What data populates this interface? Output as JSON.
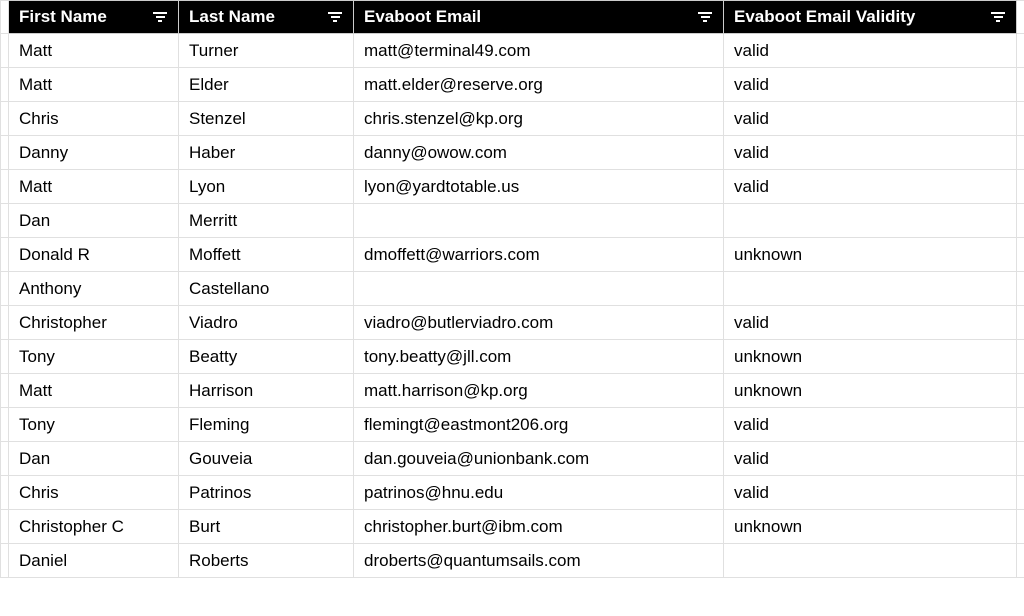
{
  "columns": [
    {
      "key": "first_name",
      "label": "First Name"
    },
    {
      "key": "last_name",
      "label": "Last Name"
    },
    {
      "key": "email",
      "label": "Evaboot Email"
    },
    {
      "key": "validity",
      "label": "Evaboot Email Validity"
    }
  ],
  "rows": [
    {
      "first_name": "Matt",
      "last_name": "Turner",
      "email": "matt@terminal49.com",
      "validity": "valid"
    },
    {
      "first_name": "Matt",
      "last_name": "Elder",
      "email": "matt.elder@reserve.org",
      "validity": "valid"
    },
    {
      "first_name": "Chris",
      "last_name": "Stenzel",
      "email": "chris.stenzel@kp.org",
      "validity": "valid"
    },
    {
      "first_name": "Danny",
      "last_name": "Haber",
      "email": "danny@owow.com",
      "validity": "valid"
    },
    {
      "first_name": "Matt",
      "last_name": "Lyon",
      "email": "lyon@yardtotable.us",
      "validity": "valid"
    },
    {
      "first_name": "Dan",
      "last_name": "Merritt",
      "email": "",
      "validity": ""
    },
    {
      "first_name": "Donald R",
      "last_name": "Moffett",
      "email": "dmoffett@warriors.com",
      "validity": "unknown"
    },
    {
      "first_name": "Anthony",
      "last_name": "Castellano",
      "email": "",
      "validity": ""
    },
    {
      "first_name": "Christopher",
      "last_name": "Viadro",
      "email": "viadro@butlerviadro.com",
      "validity": "valid"
    },
    {
      "first_name": "Tony",
      "last_name": "Beatty",
      "email": "tony.beatty@jll.com",
      "validity": "unknown"
    },
    {
      "first_name": "Matt",
      "last_name": "Harrison",
      "email": "matt.harrison@kp.org",
      "validity": "unknown"
    },
    {
      "first_name": "Tony",
      "last_name": "Fleming",
      "email": "flemingt@eastmont206.org",
      "validity": "valid"
    },
    {
      "first_name": "Dan",
      "last_name": "Gouveia",
      "email": "dan.gouveia@unionbank.com",
      "validity": "valid"
    },
    {
      "first_name": "Chris",
      "last_name": "Patrinos",
      "email": "patrinos@hnu.edu",
      "validity": "valid"
    },
    {
      "first_name": "Christopher C",
      "last_name": "Burt",
      "email": "christopher.burt@ibm.com",
      "validity": "unknown"
    },
    {
      "first_name": "Daniel",
      "last_name": "Roberts",
      "email": "droberts@quantumsails.com",
      "validity": ""
    }
  ]
}
